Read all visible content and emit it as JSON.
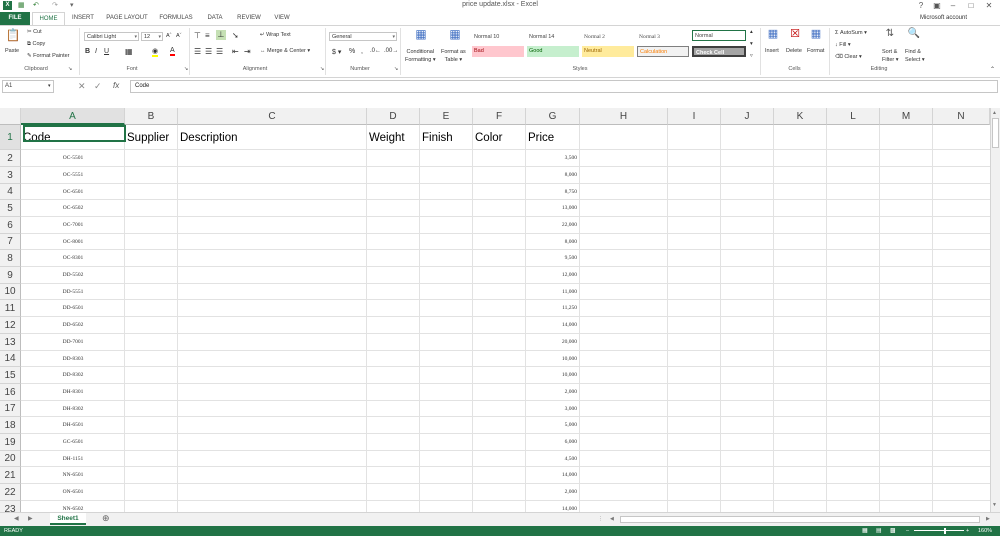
{
  "window": {
    "title": "price update.xlsx - Excel"
  },
  "account": {
    "label": "Microsoft account"
  },
  "tabs": [
    "FILE",
    "HOME",
    "INSERT",
    "PAGE LAYOUT",
    "FORMULAS",
    "DATA",
    "REVIEW",
    "VIEW"
  ],
  "ribbon": {
    "clipboard": {
      "paste": "Paste",
      "cut": "Cut",
      "copy": "Copy",
      "format_painter": "Format Painter",
      "label": "Clipboard"
    },
    "font": {
      "name": "Calibri Light",
      "size": "12",
      "label": "Font"
    },
    "alignment": {
      "wrap": "Wrap Text",
      "merge": "Merge & Center",
      "label": "Alignment"
    },
    "number": {
      "format": "General",
      "label": "Number"
    },
    "styles": {
      "conditional_1": "Conditional",
      "conditional_2": "Formatting",
      "format_as_1": "Format as",
      "format_as_2": "Table",
      "label": "Styles",
      "items": [
        {
          "label": "Normal 10",
          "bg": "#ffffff",
          "fg": "#000000"
        },
        {
          "label": "Normal 14",
          "bg": "#ffffff",
          "fg": "#000000"
        },
        {
          "label": "Normal 2",
          "bg": "#ffffff",
          "fg": "#000000"
        },
        {
          "label": "Normal 3",
          "bg": "#ffffff",
          "fg": "#000000"
        },
        {
          "label": "Normal",
          "bg": "#ffffff",
          "fg": "#000000"
        },
        {
          "label": "Bad",
          "bg": "#ffc7ce",
          "fg": "#9c0006"
        },
        {
          "label": "Good",
          "bg": "#c6efce",
          "fg": "#006100"
        },
        {
          "label": "Neutral",
          "bg": "#ffeb9c",
          "fg": "#9c6500"
        },
        {
          "label": "Calculation",
          "bg": "#f2f2f2",
          "fg": "#fa7d00"
        },
        {
          "label": "Check Cell",
          "bg": "#a5a5a5",
          "fg": "#ffffff"
        }
      ]
    },
    "cells": {
      "insert": "Insert",
      "delete": "Delete",
      "format": "Format",
      "label": "Cells"
    },
    "editing": {
      "autosum": "AutoSum",
      "fill": "Fill",
      "clear": "Clear",
      "sort_1": "Sort &",
      "sort_2": "Filter",
      "find_1": "Find &",
      "find_2": "Select",
      "label": "Editing"
    }
  },
  "formula_bar": {
    "name_box": "A1",
    "fx": "fx",
    "content": "Code"
  },
  "columns": [
    "A",
    "B",
    "C",
    "D",
    "E",
    "F",
    "G",
    "H",
    "I",
    "J",
    "K",
    "L",
    "M",
    "N"
  ],
  "headers": {
    "code": "Code",
    "supplier": "Supplier",
    "description": "Description",
    "weight": "Weight",
    "finish": "Finish",
    "color": "Color",
    "price": "Price"
  },
  "rows": [
    {
      "code": "OC-5501",
      "price": "3,500"
    },
    {
      "code": "OC-5551",
      "price": "8,000"
    },
    {
      "code": "OC-6501",
      "price": "8,750"
    },
    {
      "code": "OC-6502",
      "price": "13,000"
    },
    {
      "code": "OC-7001",
      "price": "22,000"
    },
    {
      "code": "OC-8001",
      "price": "8,000"
    },
    {
      "code": "OC-8301",
      "price": "9,500"
    },
    {
      "code": "DD-5502",
      "price": "12,000"
    },
    {
      "code": "DD-5551",
      "price": "11,000"
    },
    {
      "code": "DD-6501",
      "price": "11,250"
    },
    {
      "code": "DD-6502",
      "price": "14,000"
    },
    {
      "code": "DD-7001",
      "price": "20,000"
    },
    {
      "code": "DD-8303",
      "price": "10,000"
    },
    {
      "code": "DD-8302",
      "price": "10,000"
    },
    {
      "code": "DH-8301",
      "price": "2,000"
    },
    {
      "code": "DH-8302",
      "price": "3,000"
    },
    {
      "code": "DH-6501",
      "price": "5,000"
    },
    {
      "code": "GC-6501",
      "price": "6,000"
    },
    {
      "code": "DH-1151",
      "price": "4,500"
    },
    {
      "code": "NN-6501",
      "price": "14,000"
    },
    {
      "code": "ON-6501",
      "price": "2,000"
    },
    {
      "code": "NN-6502",
      "price": "14,000"
    }
  ],
  "row_numbers": [
    "1",
    "2",
    "3",
    "4",
    "5",
    "6",
    "7",
    "8",
    "9",
    "10",
    "11",
    "12",
    "13",
    "14",
    "15",
    "16",
    "17",
    "18",
    "19",
    "20",
    "21",
    "22",
    "23"
  ],
  "sheet_tab": "Sheet1",
  "status": {
    "text": "READY",
    "zoom": "160%"
  }
}
